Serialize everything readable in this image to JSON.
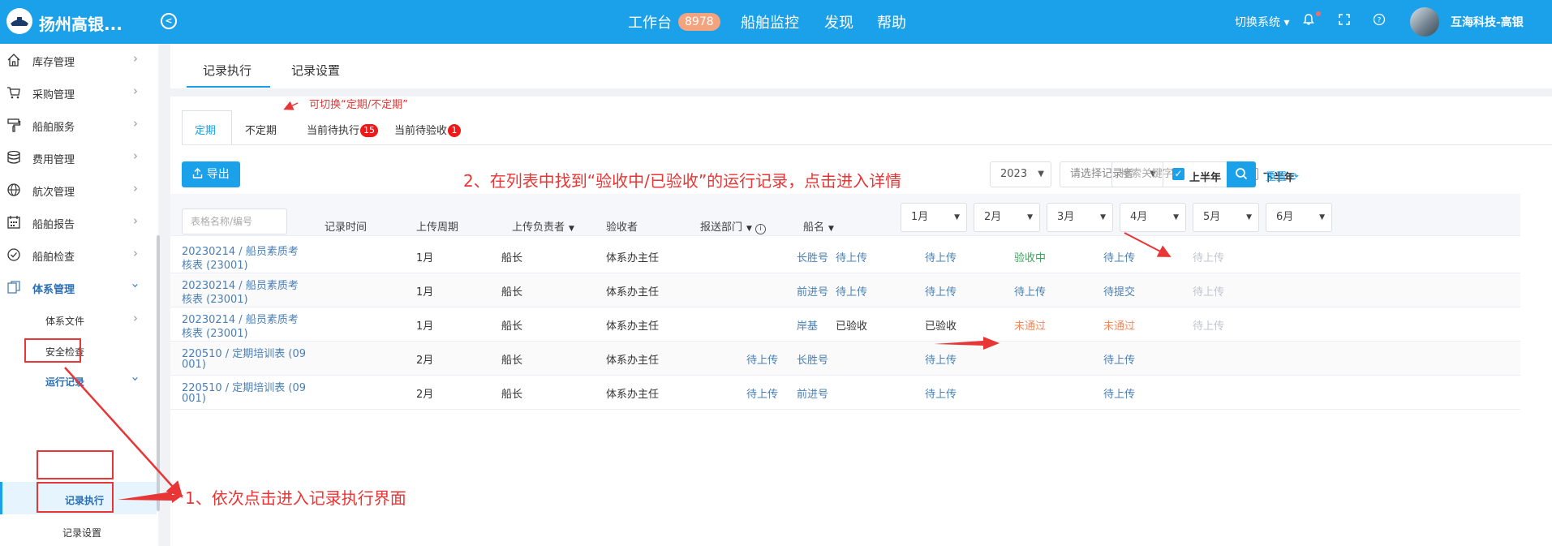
{
  "header": {
    "brand": "扬州高银...",
    "nav": [
      {
        "label": "工作台",
        "badge": "8978"
      },
      {
        "label": "船舶监控"
      },
      {
        "label": "发现"
      },
      {
        "label": "帮助"
      }
    ],
    "switch_system": "切换系统",
    "user_name": "互海科技-高银",
    "colors": {
      "primary": "#1ba0ea",
      "badge": "#f4a37f"
    }
  },
  "sidebar": {
    "items": [
      {
        "label": "库存管理",
        "icon": "home-icon"
      },
      {
        "label": "采购管理",
        "icon": "cart-icon"
      },
      {
        "label": "船舶服务",
        "icon": "brush-icon"
      },
      {
        "label": "费用管理",
        "icon": "database-icon"
      },
      {
        "label": "航次管理",
        "icon": "globe-icon"
      },
      {
        "label": "船舶报告",
        "icon": "calendar-icon"
      },
      {
        "label": "船舶检查",
        "icon": "check-circle-icon"
      },
      {
        "label": "体系管理",
        "icon": "document-icon"
      }
    ],
    "sub_items": [
      "体系文件",
      "安全检查",
      "运行记录"
    ],
    "sub_sub_items": [
      "记录执行",
      "记录设置"
    ]
  },
  "main": {
    "tabs": [
      "记录执行",
      "记录设置"
    ],
    "panel_tabs": [
      "定期",
      "不定期",
      "当前待执行",
      "当前待验收"
    ],
    "pending_execute_count": "15",
    "pending_accept_count": "1",
    "export_label": "导出",
    "year": "2023",
    "recorder_placeholder": "请选择记录者",
    "first_half": "上半年",
    "second_half": "下半年",
    "search_placeholder": "搜索关键字",
    "reset_label": "重置",
    "first_half_checked": true,
    "second_half_checked": false
  },
  "table": {
    "filter_placeholder": "表格名称/编号",
    "headers": {
      "record_time": "记录时间",
      "cycle": "上传周期",
      "owner": "上传负责者",
      "acceptor": "验收者",
      "dept": "报送部门",
      "ship": "船名"
    },
    "months": [
      "1月",
      "2月",
      "3月",
      "4月",
      "5月",
      "6月"
    ],
    "rows": [
      {
        "name_line1": "20230214 / 船员素质考",
        "name_line2": "核表 (23001)",
        "cycle": "1月",
        "owner": "船长",
        "acceptor": "体系办主任",
        "ship": "长胜号",
        "m": [
          "",
          "待上传",
          "待上传",
          "验收中",
          "待上传",
          "待上传"
        ],
        "c": [
          "",
          "blue",
          "blue",
          "green",
          "blue",
          "gray"
        ]
      },
      {
        "name_line1": "20230214 / 船员素质考",
        "name_line2": "核表 (23001)",
        "cycle": "1月",
        "owner": "船长",
        "acceptor": "体系办主任",
        "ship": "前进号",
        "m": [
          "",
          "待上传",
          "待上传",
          "待上传",
          "待提交",
          "待上传"
        ],
        "c": [
          "",
          "blue",
          "blue",
          "blue",
          "blue",
          "gray"
        ]
      },
      {
        "name_line1": "20230214 / 船员素质考",
        "name_line2": "核表 (23001)",
        "cycle": "1月",
        "owner": "船长",
        "acceptor": "体系办主任",
        "ship": "岸基",
        "m": [
          "",
          "已验收",
          "已验收",
          "未通过",
          "未通过",
          "待上传"
        ],
        "c": [
          "",
          "dark",
          "dark",
          "orange",
          "orange",
          "gray"
        ]
      },
      {
        "name_line1": "220510 / 定期培训表 (09",
        "name_line2": "001)",
        "cycle": "2月",
        "owner": "船长",
        "acceptor": "体系办主任",
        "ship": "长胜号",
        "m": [
          "待上传",
          "",
          "待上传",
          "",
          "待上传",
          ""
        ],
        "c": [
          "blue",
          "",
          "blue",
          "",
          "blue",
          ""
        ]
      },
      {
        "name_line1": "220510 / 定期培训表 (09",
        "name_line2": "001)",
        "cycle": "2月",
        "owner": "船长",
        "acceptor": "体系办主任",
        "ship": "前进号",
        "m": [
          "待上传",
          "",
          "待上传",
          "",
          "待上传",
          ""
        ],
        "c": [
          "blue",
          "",
          "blue",
          "",
          "blue",
          ""
        ]
      }
    ]
  },
  "annotations": {
    "toggle_hint": "可切换“定期/不定期”",
    "step1": "1、依次点击进入记录执行界面",
    "step2": "2、在列表中找到“验收中/已验收”的运行记录，点击进入详情",
    "color": "#e83535"
  }
}
